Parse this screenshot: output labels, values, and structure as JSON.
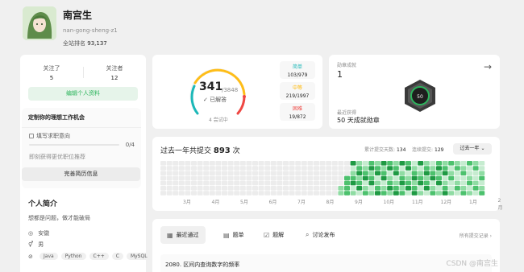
{
  "profile": {
    "username": "南宫生",
    "handle": "nan-gong-sheng-z1",
    "rank_label": "全站排名",
    "rank_value": "93,137"
  },
  "follow": {
    "following_label": "关注了",
    "following_count": "5",
    "followers_label": "关注者",
    "followers_count": "12"
  },
  "left": {
    "edit_label": "编辑个人资料",
    "job_title": "定制你的理想工作机会",
    "job_fill": "填写求职意向",
    "job_progress": "0/4",
    "job_tip": "即刻获得更优职位推荐",
    "resume_label": "完善简历信息",
    "intro_title": "个人简介",
    "intro_text": "想都是问题，做才能破局",
    "location": "安徽",
    "gender": "男",
    "tags": [
      "Java",
      "Python",
      "C++",
      "C",
      "MySQL"
    ]
  },
  "stats": {
    "solved": "341",
    "total": "/3848",
    "solved_label": "已解答",
    "attempting": "4 尝试中",
    "easy_label": "简单",
    "easy_count": "103/979",
    "medium_label": "中等",
    "medium_count": "219/1997",
    "hard_label": "困难",
    "hard_count": "19/872",
    "colors": {
      "easy": "#1cb8b8",
      "medium": "#ffb700",
      "hard": "#ef4743"
    }
  },
  "badges": {
    "label": "勋章成就",
    "count": "1",
    "recent_label": "最近获得",
    "recent_badge": "50 天成就勋章",
    "badge_number": "50"
  },
  "heatmap": {
    "title_prefix": "过去一年共提交",
    "count": "893",
    "title_suffix": "次",
    "total_days_label": "累计提交天数:",
    "total_days": "134",
    "streak_label": "连续提交:",
    "streak": "129",
    "range_select": "过去一年",
    "months": [
      "3月",
      "4月",
      "5月",
      "6月",
      "7月",
      "8月",
      "9月",
      "10月",
      "11月",
      "12月",
      "1月",
      "2月"
    ]
  },
  "tabs": {
    "items": [
      "最近通过",
      "题单",
      "题解",
      "讨论发布"
    ],
    "all_records": "所有提交记录 ›",
    "first_problem": "2080. 区间内查询数字的频率",
    "watermark": "CSDN @南宫生"
  }
}
